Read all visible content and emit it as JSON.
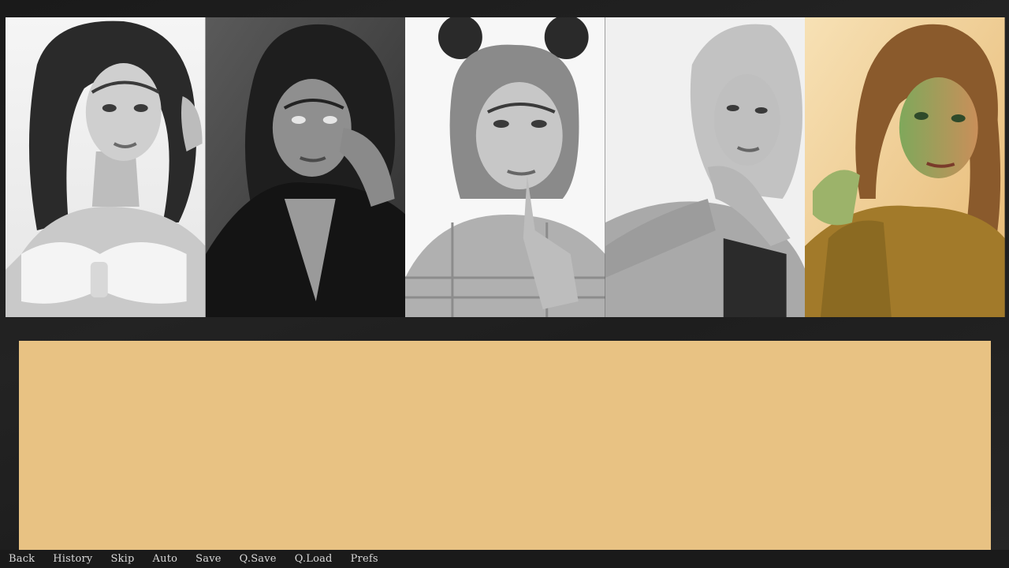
{
  "portraits": [
    {
      "id": "character-1",
      "tone": "grayscale",
      "bg": "#f2f2f2"
    },
    {
      "id": "character-2",
      "tone": "grayscale",
      "bg": "#4a4a4a"
    },
    {
      "id": "character-3",
      "tone": "grayscale",
      "bg": "#f5f5f5"
    },
    {
      "id": "character-4",
      "tone": "grayscale",
      "bg": "#efefef"
    },
    {
      "id": "character-5",
      "tone": "color",
      "bg": "#f3d9a8"
    }
  ],
  "dialogue": {
    "speaker": "",
    "text": "",
    "box_color": "#e8c283"
  },
  "quick_menu": {
    "back": "Back",
    "history": "History",
    "skip": "Skip",
    "auto": "Auto",
    "save": "Save",
    "qsave": "Q.Save",
    "qload": "Q.Load",
    "prefs": "Prefs"
  }
}
